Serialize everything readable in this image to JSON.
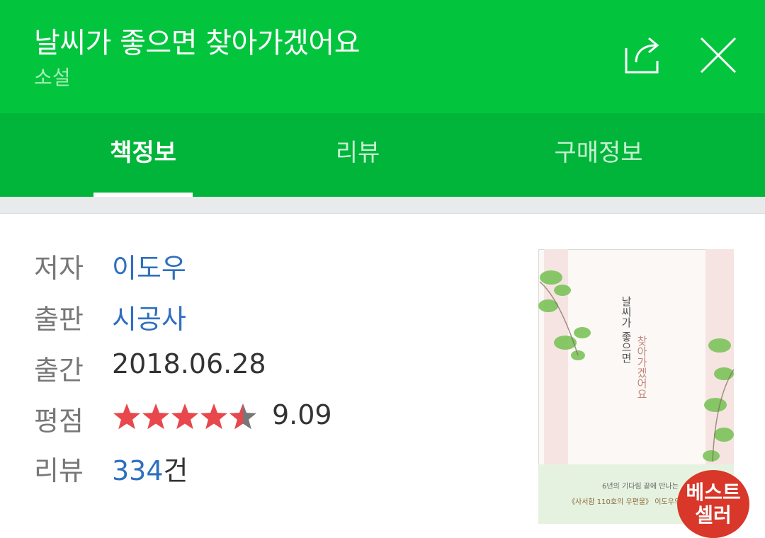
{
  "header": {
    "title": "날씨가 좋으면 찾아가겠어요",
    "subtitle": "소설",
    "share_icon": "share-icon",
    "close_icon": "close-icon",
    "background": "#03c53d"
  },
  "tabs": [
    {
      "label": "책정보",
      "active": true
    },
    {
      "label": "리뷰",
      "active": false
    },
    {
      "label": "구매정보",
      "active": false
    }
  ],
  "details": {
    "author_label": "저자",
    "author": "이도우",
    "publisher_label": "출판",
    "publisher": "시공사",
    "date_label": "출간",
    "date": "2018.06.28",
    "rating_label": "평점",
    "rating_value": "9.09",
    "rating_stars": 4.5,
    "reviews_label": "리뷰",
    "reviews_count": "334",
    "reviews_suffix": "건"
  },
  "cover": {
    "title_line1": "날씨가 좋으면",
    "title_line2": "찾아가겠어요",
    "blurb_line1": "6년의 기다림 끝에 만나는",
    "blurb_line2": "《사서함 110호의 우편물》 이도우의 최",
    "badge_line1": "베스트",
    "badge_line2": "셀러"
  },
  "colors": {
    "brand_green": "#03c53d",
    "tab_bar_green": "#00b539",
    "link_blue": "#2e6fc1",
    "star_red": "#e8474c",
    "badge_red": "#d8372a"
  }
}
